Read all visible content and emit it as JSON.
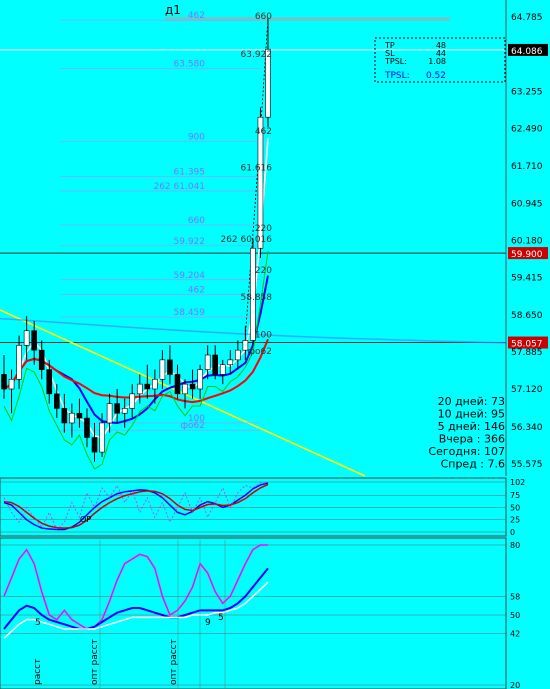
{
  "colors": {
    "background": "#00ffff",
    "candle_body": "#ffffff",
    "candle_wick": "#000000",
    "ma_fast": "#ffffff",
    "ma_mid": "#0000ff",
    "ma_slow": "#ff0000",
    "ma_long": "#4488ff",
    "trend_line": "#ffff00",
    "fib_line": "#9999ff",
    "fib_text": "#7777ff",
    "level_line": "#ff0000",
    "osc_main": "#0000ff",
    "osc_signal": "#cc0000",
    "osc_dotted": "#ff00ff",
    "rsi_magenta": "#ff00ff",
    "stop_line": "#00cc00",
    "price_label_bg": "#cc0000"
  },
  "chart_data": {
    "type": "candlestick",
    "title": "д1",
    "current_price": "64.086",
    "support_price": "59.900",
    "marked_price": "58.057",
    "price_axis": {
      "labels": [
        "64.785",
        "64.086",
        "63.255",
        "62.490",
        "61.710",
        "60.945",
        "60.180",
        "59.900",
        "59.415",
        "58.650",
        "58.057",
        "57.885",
        "57.120",
        "56.340",
        "55.575"
      ],
      "range": [
        55.4,
        65.0
      ]
    },
    "candles": [
      {
        "o": 57.4,
        "h": 57.8,
        "l": 56.9,
        "c": 57.1
      },
      {
        "o": 57.1,
        "h": 57.5,
        "l": 56.6,
        "c": 57.3
      },
      {
        "o": 57.3,
        "h": 58.2,
        "l": 57.1,
        "c": 58.0
      },
      {
        "o": 58.0,
        "h": 58.6,
        "l": 57.7,
        "c": 58.3
      },
      {
        "o": 58.3,
        "h": 58.5,
        "l": 57.6,
        "c": 57.9
      },
      {
        "o": 57.9,
        "h": 58.1,
        "l": 57.3,
        "c": 57.5
      },
      {
        "o": 57.5,
        "h": 57.7,
        "l": 56.8,
        "c": 57.0
      },
      {
        "o": 57.0,
        "h": 57.2,
        "l": 56.5,
        "c": 56.7
      },
      {
        "o": 56.7,
        "h": 57.0,
        "l": 56.2,
        "c": 56.4
      },
      {
        "o": 56.4,
        "h": 56.8,
        "l": 56.1,
        "c": 56.6
      },
      {
        "o": 56.6,
        "h": 56.9,
        "l": 56.3,
        "c": 56.5
      },
      {
        "o": 56.5,
        "h": 56.7,
        "l": 55.9,
        "c": 56.1
      },
      {
        "o": 56.1,
        "h": 56.4,
        "l": 55.6,
        "c": 55.8
      },
      {
        "o": 55.8,
        "h": 56.6,
        "l": 55.7,
        "c": 56.4
      },
      {
        "o": 56.4,
        "h": 57.0,
        "l": 56.2,
        "c": 56.8
      },
      {
        "o": 56.8,
        "h": 57.1,
        "l": 56.4,
        "c": 56.6
      },
      {
        "o": 56.6,
        "h": 56.9,
        "l": 56.3,
        "c": 56.7
      },
      {
        "o": 56.7,
        "h": 57.2,
        "l": 56.5,
        "c": 57.0
      },
      {
        "o": 57.0,
        "h": 57.4,
        "l": 56.8,
        "c": 57.2
      },
      {
        "o": 57.2,
        "h": 57.6,
        "l": 56.9,
        "c": 57.1
      },
      {
        "o": 57.1,
        "h": 57.5,
        "l": 56.8,
        "c": 57.3
      },
      {
        "o": 57.3,
        "h": 57.9,
        "l": 57.1,
        "c": 57.7
      },
      {
        "o": 57.7,
        "h": 58.0,
        "l": 57.2,
        "c": 57.4
      },
      {
        "o": 57.4,
        "h": 57.6,
        "l": 56.9,
        "c": 57.0
      },
      {
        "o": 57.0,
        "h": 57.3,
        "l": 56.7,
        "c": 57.2
      },
      {
        "o": 57.2,
        "h": 57.5,
        "l": 56.9,
        "c": 57.1
      },
      {
        "o": 57.1,
        "h": 57.6,
        "l": 56.9,
        "c": 57.5
      },
      {
        "o": 57.5,
        "h": 58.0,
        "l": 57.3,
        "c": 57.8
      },
      {
        "o": 57.8,
        "h": 58.0,
        "l": 57.3,
        "c": 57.4
      },
      {
        "o": 57.4,
        "h": 57.7,
        "l": 57.2,
        "c": 57.6
      },
      {
        "o": 57.6,
        "h": 57.9,
        "l": 57.4,
        "c": 57.7
      },
      {
        "o": 57.7,
        "h": 58.1,
        "l": 57.5,
        "c": 57.9
      },
      {
        "o": 57.9,
        "h": 58.4,
        "l": 57.7,
        "c": 58.1
      },
      {
        "o": 58.1,
        "h": 60.2,
        "l": 58.0,
        "c": 60.0
      },
      {
        "o": 60.0,
        "h": 62.9,
        "l": 59.8,
        "c": 62.7
      },
      {
        "o": 62.7,
        "h": 64.7,
        "l": 62.5,
        "c": 64.1
      }
    ],
    "fib_levels": [
      {
        "label": "462",
        "price": 64.7
      },
      {
        "label": "63.580",
        "price": 63.7
      },
      {
        "label": "900",
        "price": 62.2
      },
      {
        "label": "61.395",
        "price": 61.48
      },
      {
        "label": "262 61.041",
        "price": 61.18
      },
      {
        "label": "660",
        "price": 60.48
      },
      {
        "label": "59.922",
        "price": 60.05
      },
      {
        "label": "59.204",
        "price": 59.35
      },
      {
        "label": "462",
        "price": 59.05
      },
      {
        "label": "58.459",
        "price": 58.58
      },
      {
        "label": "100",
        "price": 56.4
      },
      {
        "label": "фо62",
        "price": 56.25
      }
    ],
    "target_labels": [
      {
        "label": "660",
        "price": 64.78
      },
      {
        "label": "63.922",
        "price": 64.0
      },
      {
        "label": "462",
        "price": 62.42
      },
      {
        "label": "61.616",
        "price": 61.66
      },
      {
        "label": "220",
        "price": 60.42
      },
      {
        "label": "262 60.016",
        "price": 60.19
      },
      {
        "label": "220",
        "price": 59.55
      },
      {
        "label": "58.858",
        "price": 59.0
      },
      {
        "label": "100",
        "price": 58.22
      },
      {
        "label": "фо62",
        "price": 57.88
      }
    ],
    "info_box": [
      {
        "k": "TP",
        "v": "48"
      },
      {
        "k": "SL",
        "v": "44"
      },
      {
        "k": "TPSL:",
        "v": "1.08"
      }
    ],
    "info_box_sub": {
      "k": "TPSL:",
      "v": "0.52"
    },
    "stats": [
      {
        "label": "20 дней:",
        "value": "73"
      },
      {
        "label": "10 дней:",
        "value": "95"
      },
      {
        "label": "5 дней:",
        "value": "146"
      },
      {
        "label": "Вчера :",
        "value": "366"
      },
      {
        "label": "Сегодня:",
        "value": "107"
      },
      {
        "label": "Спред :",
        "value": "7.6"
      }
    ],
    "osc1_axis": [
      "102",
      "75",
      "50",
      "25",
      "0"
    ],
    "osc1_label": "ОР",
    "osc2_axis": [
      "80",
      "58",
      "50",
      "42",
      "20"
    ],
    "osc2_notes": [
      "5",
      "9",
      "5"
    ],
    "vertical_notes": [
      "расст",
      "опт расст",
      "опт расст"
    ]
  }
}
